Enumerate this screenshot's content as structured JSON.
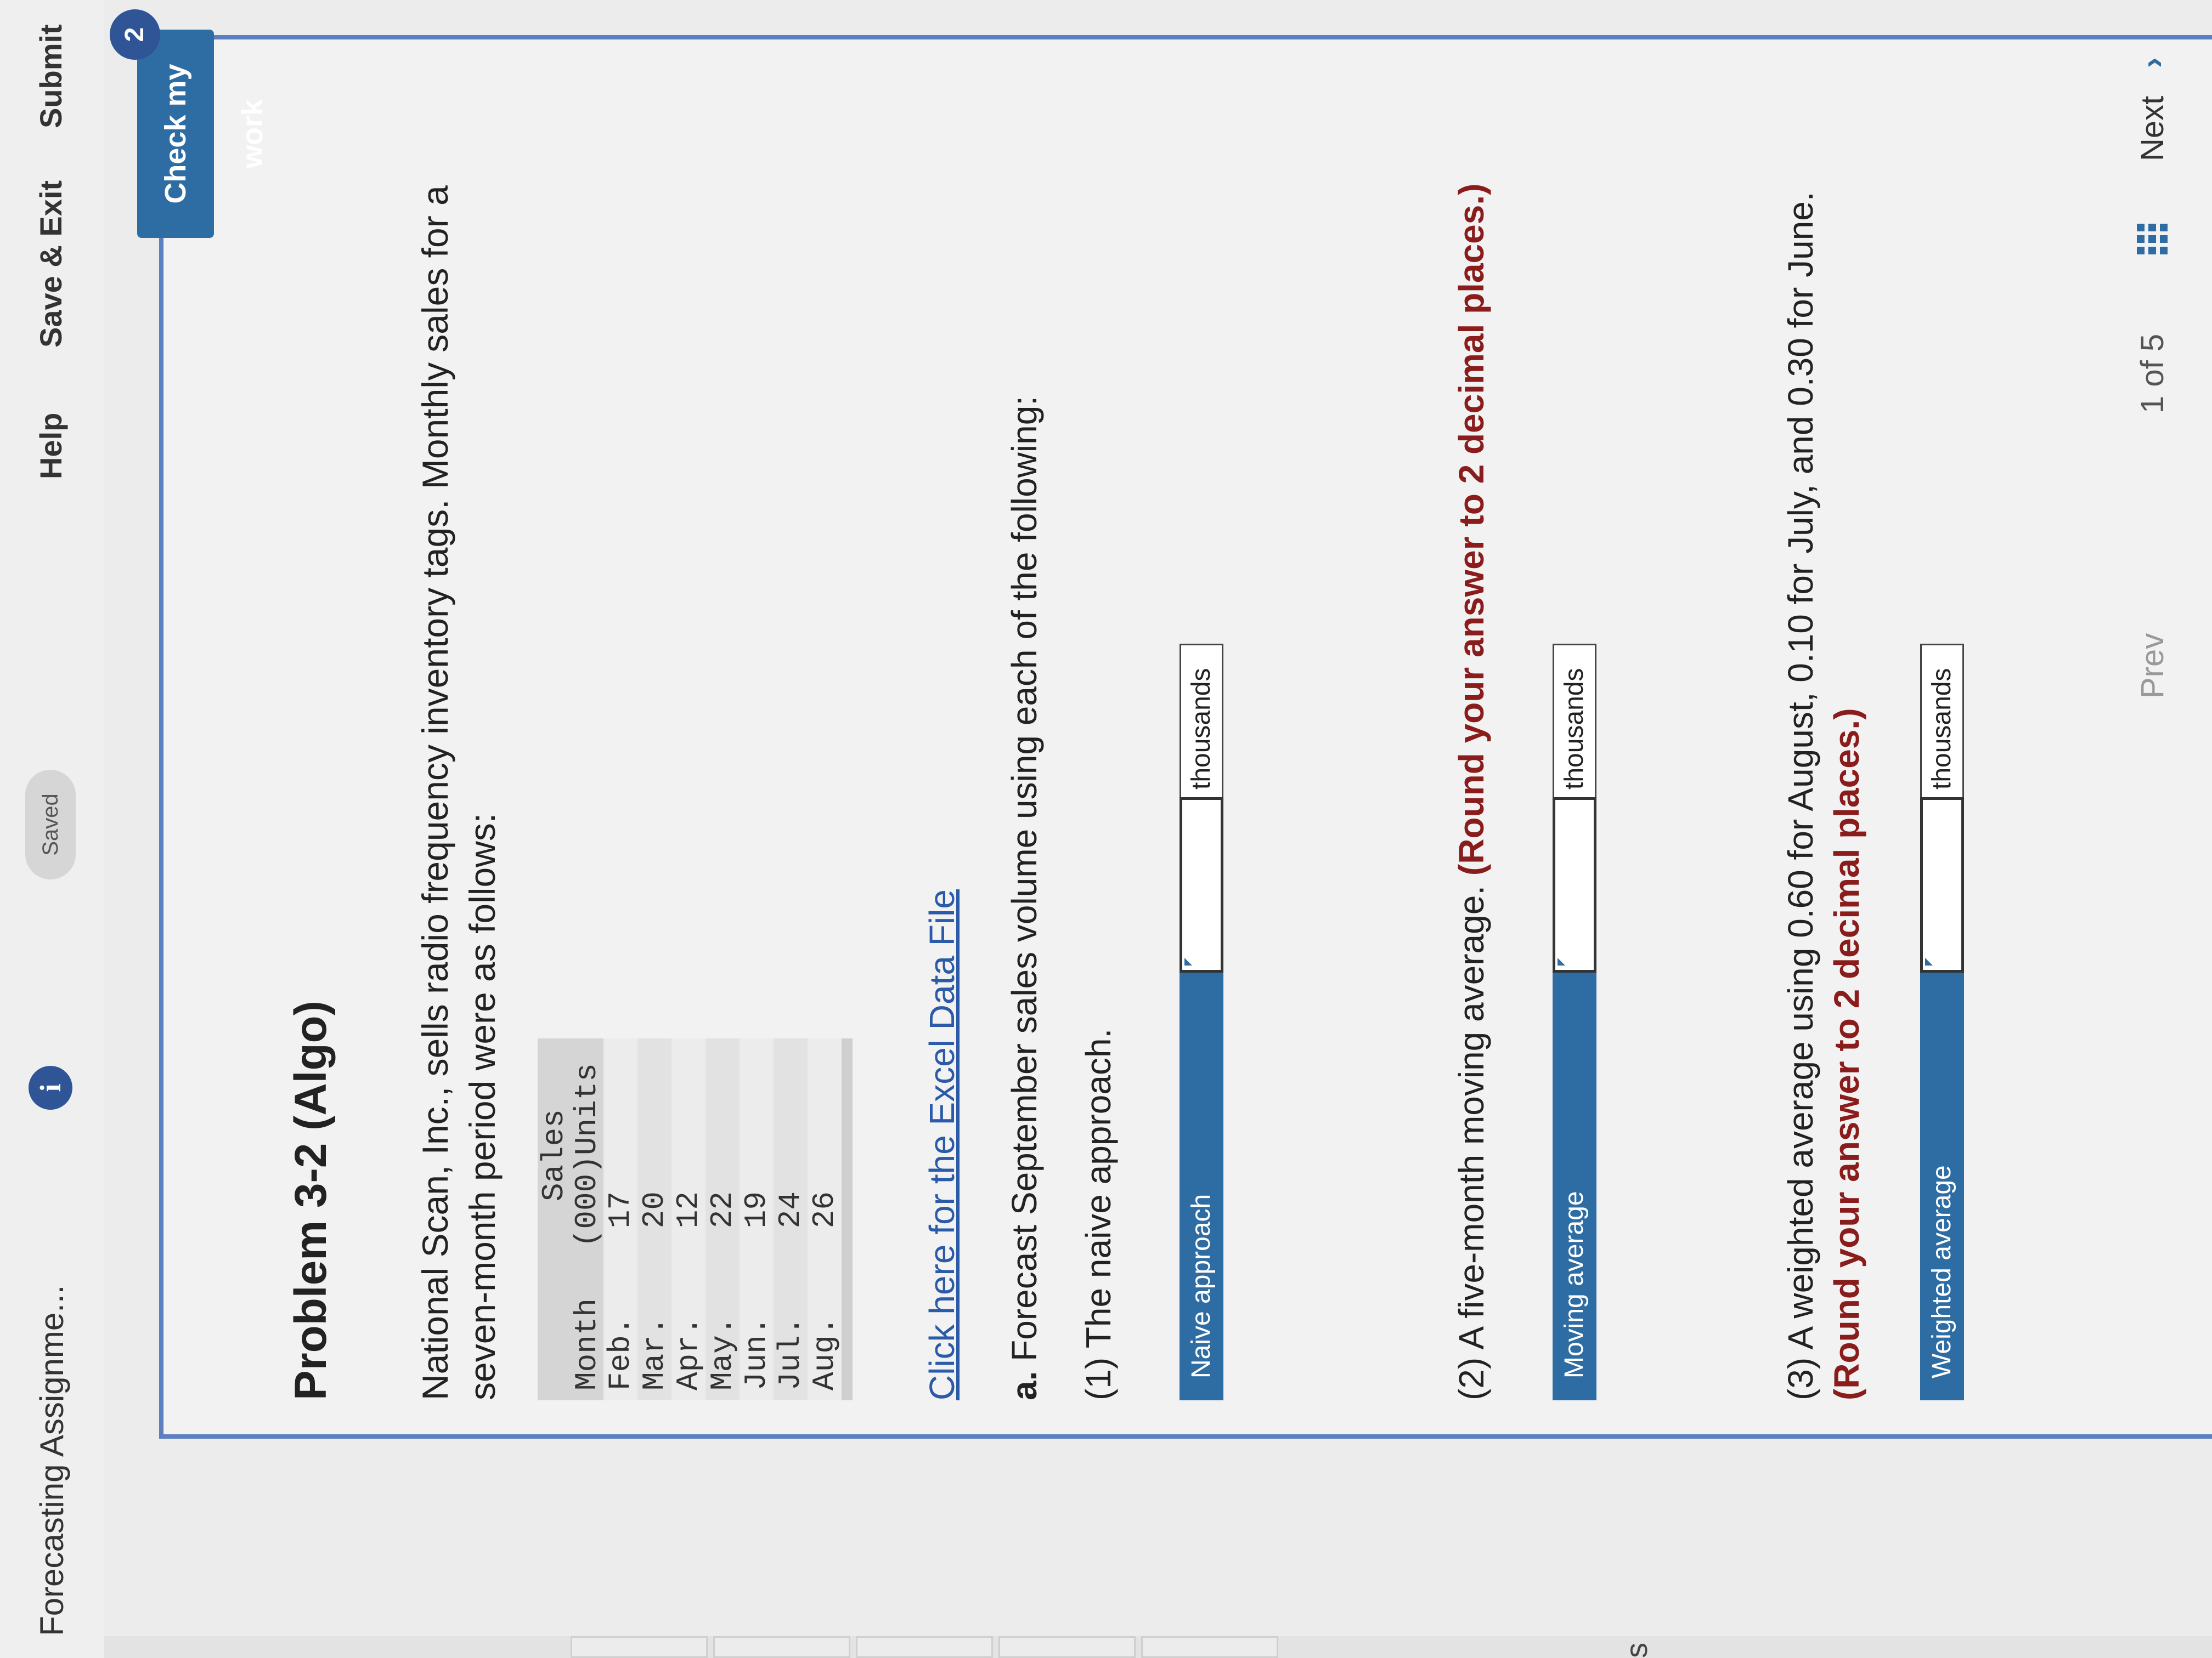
{
  "header": {
    "title": "Forecasting Assignme...",
    "info_icon": "i",
    "saved_label": "Saved",
    "help": "Help",
    "save_exit": "Save & Exit",
    "submit": "Submit"
  },
  "sidebar": {
    "stub_text": "s"
  },
  "actions": {
    "check_my_work": "Check my work",
    "check_badge": "2"
  },
  "problem": {
    "title": "Problem 3-2 (Algo)",
    "intro": "National Scan, Inc., sells radio frequency inventory tags. Monthly sales for a seven-month period were as follows:",
    "table": {
      "header_month": "Month",
      "header_sales_line1": "Sales",
      "header_sales_line2": "(000)Units",
      "rows": [
        {
          "month": "Feb.",
          "units": "17"
        },
        {
          "month": "Mar.",
          "units": "20"
        },
        {
          "month": "Apr.",
          "units": "12"
        },
        {
          "month": "May.",
          "units": "22"
        },
        {
          "month": "Jun.",
          "units": "19"
        },
        {
          "month": "Jul.",
          "units": "24"
        },
        {
          "month": "Aug.",
          "units": "26"
        }
      ]
    },
    "excel_link": "Click here for the Excel Data File",
    "part_a_prefix": "a.",
    "part_a_text": " Forecast September sales volume using each of the following:",
    "q1": {
      "text": "(1) The naive approach.",
      "label": "Naive approach",
      "value": "",
      "unit": "thousands"
    },
    "q2": {
      "text": "(2) A five-month moving average. ",
      "note": "(Round your answer to 2 decimal places.)",
      "label": "Moving average",
      "value": "",
      "unit": "thousands"
    },
    "q3": {
      "text": "(3) A weighted average using 0.60 for August, 0.10 for July, and 0.30 for June. ",
      "note": "(Round your answer to 2 decimal places.)",
      "label": "Weighted average",
      "value": "",
      "unit": "thousands"
    }
  },
  "pager": {
    "prev": "Prev",
    "page_of": "1 of 5",
    "next": "Next",
    "next_chevron": "›"
  }
}
